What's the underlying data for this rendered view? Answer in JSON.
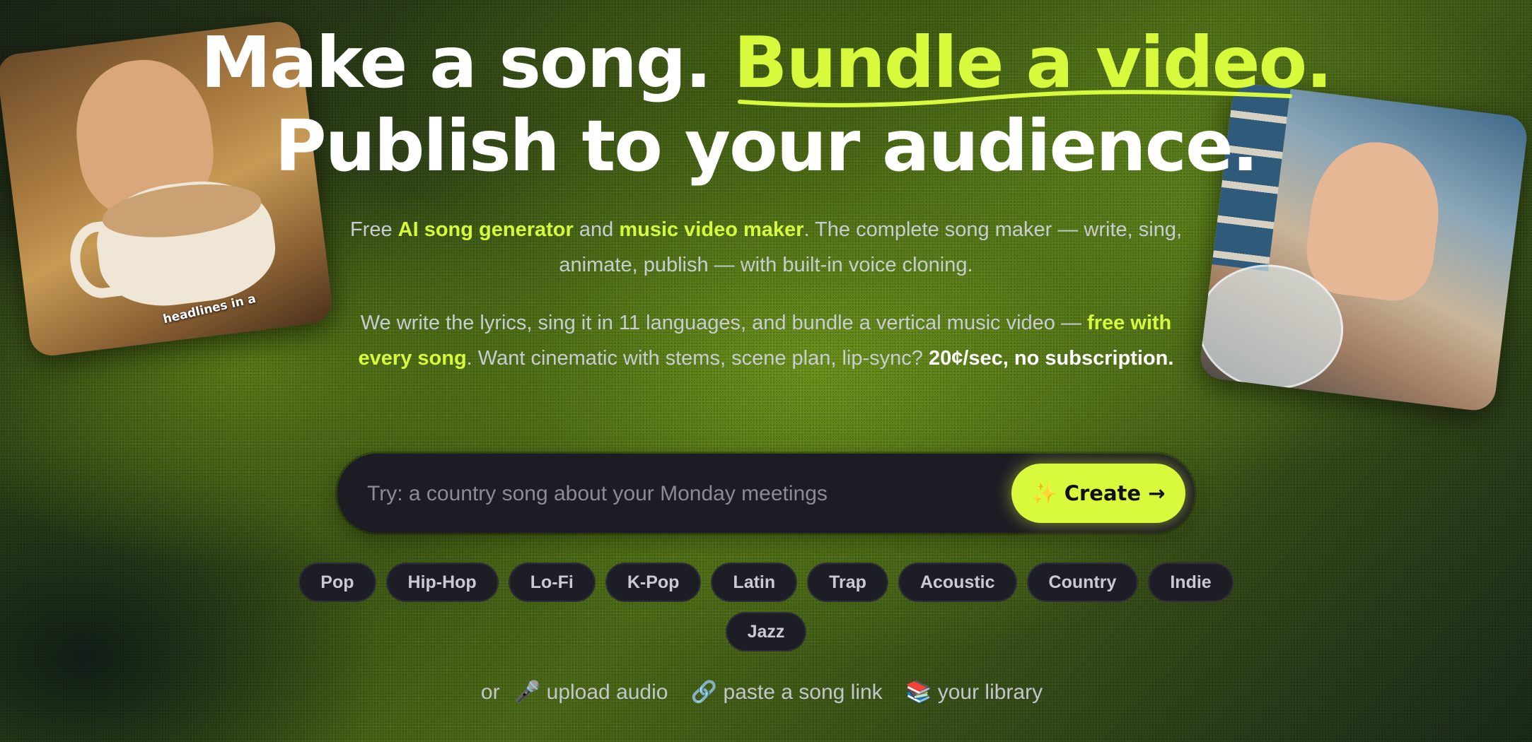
{
  "hero": {
    "line1_part1": "Make a song.",
    "line1_accent": "Bundle a video.",
    "line2": "Publish to your audience."
  },
  "photos": {
    "left_caption": "headlines in a"
  },
  "intro": {
    "p1_a": "Free ",
    "p1_hl1": "AI song generator",
    "p1_b": " and ",
    "p1_hl2": "music video maker",
    "p1_c": ". The complete song maker — write, sing, animate, publish — with built-in voice cloning.",
    "p2_a": "We write the lyrics, sing it in 11 languages, and bundle a vertical music video — ",
    "p2_hl": "free with every song",
    "p2_b": ". Want cinematic with stems, scene plan, lip-sync? ",
    "p2_strong": "20¢/sec, no subscription."
  },
  "prompt": {
    "placeholder": "Try: a country song about your Monday meetings",
    "value": "",
    "create_label": "✨ Create →"
  },
  "genres": [
    "Pop",
    "Hip-Hop",
    "Lo-Fi",
    "K-Pop",
    "Latin",
    "Trap",
    "Acoustic",
    "Country",
    "Indie",
    "Jazz"
  ],
  "alt": {
    "prefix": "or",
    "upload_icon": "🎤",
    "upload_label": "upload audio",
    "link_icon": "🔗",
    "link_label": "paste a song link",
    "library_icon": "📚",
    "library_label": "your library"
  },
  "colors": {
    "accent": "#d7fb3c",
    "background": "#12131a"
  }
}
